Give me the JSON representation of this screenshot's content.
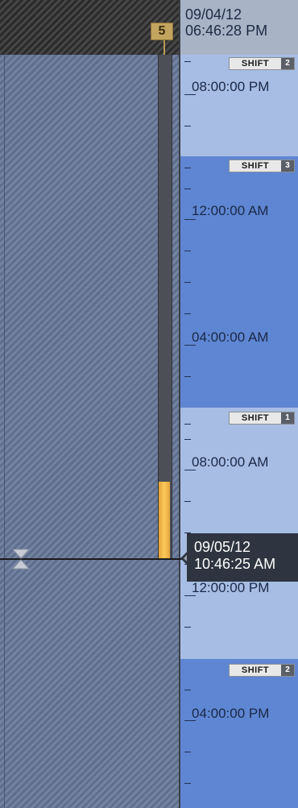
{
  "header": {
    "date": "09/04/12",
    "time": "06:46:28 PM"
  },
  "badge": {
    "value": "5"
  },
  "timeline": {
    "labels": [
      "08:00:00 PM",
      "12:00:00 AM",
      "04:00:00 AM",
      "08:00:00 AM",
      "12:00:00 PM",
      "04:00:00 PM"
    ],
    "shifts": [
      {
        "text": "SHIFT",
        "number": "2"
      },
      {
        "text": "SHIFT",
        "number": "3"
      },
      {
        "text": "SHIFT",
        "number": "1"
      },
      {
        "text": "SHIFT",
        "number": "2"
      }
    ]
  },
  "current": {
    "date": "09/05/12",
    "time": "10:46:25 AM"
  },
  "colors": {
    "shift_light": "#a7bde3",
    "shift_dark": "#5e86d2",
    "progress_fill": "#fbc95a",
    "lane_hatch": "#6c7a98"
  },
  "icons": {
    "marker": "hourglass-icon"
  }
}
